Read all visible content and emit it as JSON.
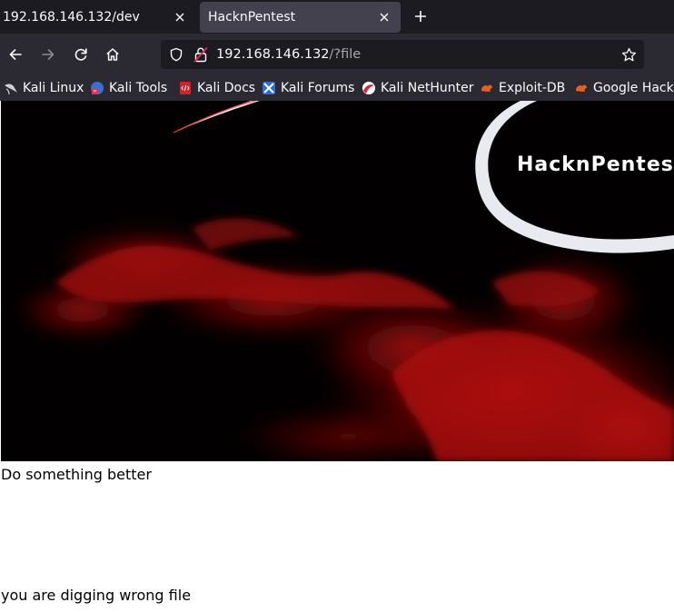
{
  "browser": {
    "tabs": [
      {
        "title": "192.168.146.132/dev",
        "active": false
      },
      {
        "title": "HacknPentest",
        "active": true
      }
    ],
    "new_tab_icon": "plus-icon",
    "url": {
      "host": "192.168.146.132",
      "rest": "/?file"
    },
    "bookmarks": [
      {
        "label": "Kali Linux",
        "icon": "kali-dragon-icon"
      },
      {
        "label": "Kali Tools",
        "icon": "kali-tools-icon"
      },
      {
        "label": "Kali Docs",
        "icon": "kali-docs-icon"
      },
      {
        "label": "Kali Forums",
        "icon": "kali-forums-icon"
      },
      {
        "label": "Kali NetHunter",
        "icon": "nethunter-icon"
      },
      {
        "label": "Exploit-DB",
        "icon": "exploit-db-icon"
      },
      {
        "label": "Google Hacking DB",
        "icon": "ghdb-icon"
      }
    ],
    "colors": {
      "tabbar": "#1c1b22",
      "toolbar": "#2b2a33",
      "active_tab": "#42414d",
      "urlbar": "#1c1b22"
    }
  },
  "page": {
    "banner": {
      "brand": "HacknPentest"
    },
    "text1": "Do something better",
    "text2": "you are digging wrong file"
  }
}
